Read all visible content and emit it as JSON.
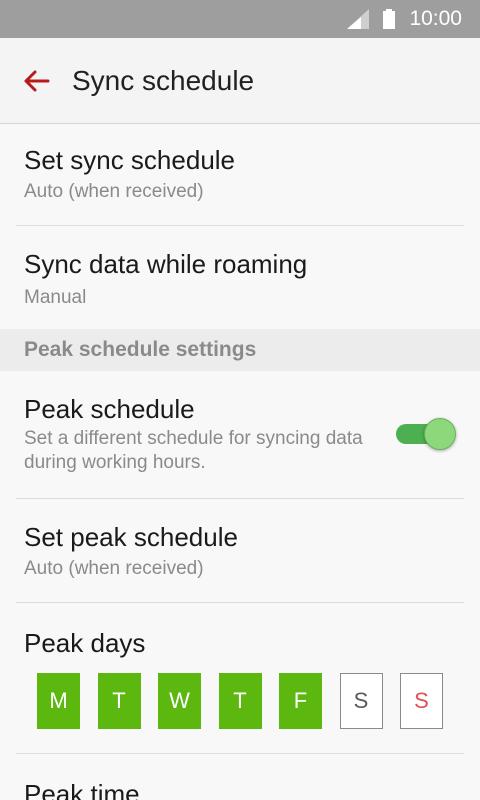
{
  "status_bar": {
    "time": "10:00",
    "icons": [
      "signal-icon",
      "battery-icon"
    ]
  },
  "action_bar": {
    "title": "Sync schedule",
    "back_icon": "arrow-back-icon",
    "accent_color": "#b71c1c"
  },
  "items": {
    "set_sync_schedule": {
      "title": "Set sync schedule",
      "value": "Auto (when received)"
    },
    "sync_roaming": {
      "title": "Sync data while roaming",
      "value": "Manual"
    }
  },
  "section_header": "Peak schedule settings",
  "peak": {
    "title": "Peak schedule",
    "description": "Set a different schedule for syncing data during working hours.",
    "enabled": true,
    "toggle_color": "#4caf50"
  },
  "set_peak_schedule": {
    "title": "Set peak schedule",
    "value": "Auto (when received)"
  },
  "peak_days": {
    "title": "Peak days",
    "days": [
      {
        "label": "M",
        "selected": true
      },
      {
        "label": "T",
        "selected": true
      },
      {
        "label": "W",
        "selected": true
      },
      {
        "label": "T",
        "selected": true
      },
      {
        "label": "F",
        "selected": true
      },
      {
        "label": "S",
        "selected": false
      },
      {
        "label": "S",
        "selected": false
      }
    ],
    "selected_color": "#5cb80f"
  },
  "peak_time": {
    "title": "Peak time"
  }
}
